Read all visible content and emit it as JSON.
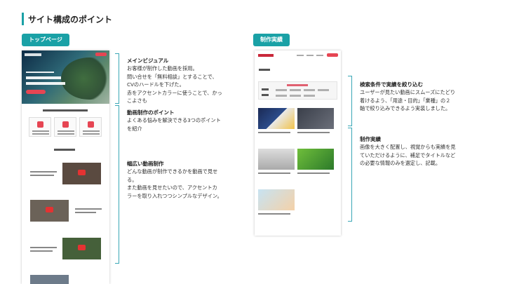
{
  "page": {
    "title": "サイト構成のポイント"
  },
  "tags": {
    "top": "トップページ",
    "works": "制作実績"
  },
  "left_notes": [
    {
      "heading": "メインビジュアル",
      "lines": [
        "お客様が制作した動画を採用。",
        "問い合せを「無料相談」とすることで、",
        "CVのハードルを下げた。",
        "赤をアクセントカラーに使うことで、かっ",
        "こよさも"
      ]
    },
    {
      "heading": "動画制作のポイント",
      "lines": [
        "よくある悩みを解決できる3つのポイント",
        "を紹介"
      ]
    },
    {
      "heading": "幅広い動画制作",
      "lines": [
        "どんな動画が制作できるかを動画で見せ",
        "る。",
        "また動画を見せたいので、アクセントカ",
        "ラーを取り入れつつシンプルなデザイン。"
      ]
    }
  ],
  "right_notes": [
    {
      "heading": "検索条件で実績を絞り込む",
      "lines": [
        "ユーザーが見たい動画にスムーズにたどり",
        "着けるよう、「用途・目的」「業種」の２",
        "軸で絞り込みできるよう実装しました。"
      ]
    },
    {
      "heading": "制作実績",
      "lines": [
        "画像を大きく配置し、視覚からも実績を見",
        "ていただけるように、補足でタイトルなど",
        "の必要な情報のみを選定し、記載。"
      ]
    }
  ],
  "colors": {
    "accent": "#1aa1a6",
    "bracket": "#3aa7b6",
    "mock_red": "#e64553"
  }
}
